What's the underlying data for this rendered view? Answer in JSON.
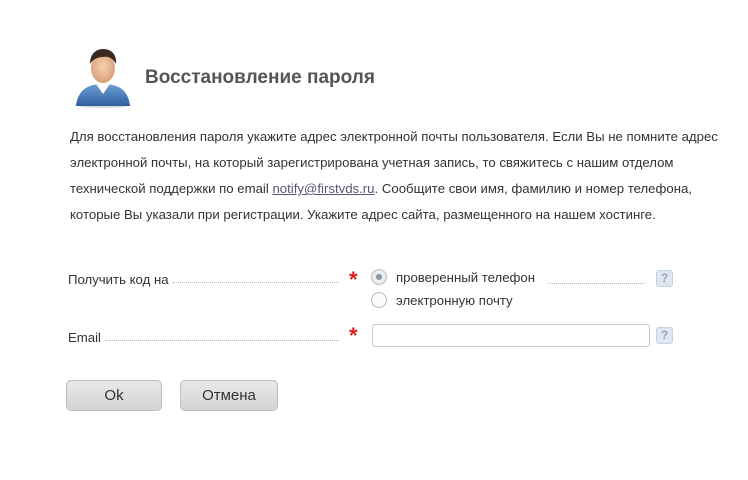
{
  "header": {
    "title": "Восстановление пароля",
    "avatar_icon": "user-avatar-icon"
  },
  "description": {
    "text_before_link": "Для восстановления пароля укажите адрес электронной почты пользователя. Если Вы не помните адрес электронной почты, на который зарегистрирована учетная запись, то свяжитесь с нашим отделом технической поддержки по email ",
    "link_text": "notify@firstvds.ru",
    "text_after_link": ". Сообщите свои имя, фамилию и номер телефона, которые Вы указали при регистрации. Укажите адрес сайта, размещенного на нашем хостинге."
  },
  "form": {
    "code_to": {
      "label": "Получить код на",
      "required_mark": "*",
      "options": [
        {
          "label": "проверенный телефон",
          "selected": true
        },
        {
          "label": "электронную почту",
          "selected": false
        }
      ],
      "help": "?"
    },
    "email": {
      "label": "Email",
      "required_mark": "*",
      "value": "",
      "placeholder": "",
      "help": "?"
    }
  },
  "buttons": {
    "ok": "Ok",
    "cancel": "Отмена"
  },
  "colors": {
    "required": "#d9201b",
    "title": "#555555",
    "help_bg": "#dfe8f0"
  }
}
